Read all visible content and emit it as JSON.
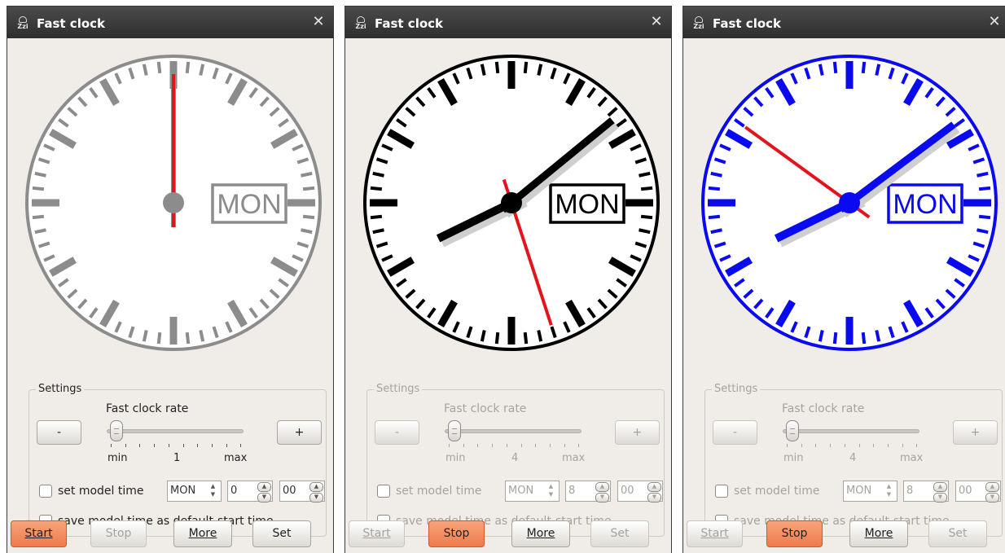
{
  "windows": [
    {
      "title": "Fast clock",
      "close_glyph": "✕",
      "clock": {
        "time": {
          "hour": 12,
          "minute": 0,
          "second": 0
        },
        "day_label": "MON",
        "face_color": "#8c8c8c",
        "second_hand_color": "#e3141c",
        "hands_visible": false
      },
      "settings": {
        "legend": "Settings",
        "rate_label": "Fast clock rate",
        "minus_label": "-",
        "plus_label": "+",
        "rate_min_label": "min",
        "rate_value": "1",
        "rate_max_label": "max",
        "rate_slider_fraction": 0.05,
        "set_model_time_label": "set model time",
        "set_model_time_checked": false,
        "day_value": "MON",
        "hour_value": "0",
        "minute_value": "00",
        "save_default_label": "save model time as default-start time",
        "save_default_checked": false,
        "controls_enabled": true
      },
      "buttons": {
        "start_label": "Start",
        "stop_label": "Stop",
        "more_label": "More",
        "set_label": "Set",
        "active": "start"
      }
    },
    {
      "title": "Fast clock",
      "close_glyph": "✕",
      "clock": {
        "time": {
          "hour": 8,
          "minute": 8,
          "second": 27
        },
        "day_label": "MON",
        "face_color": "#000000",
        "second_hand_color": "#e3141c",
        "hands_visible": true
      },
      "settings": {
        "legend": "Settings",
        "rate_label": "Fast clock rate",
        "minus_label": "-",
        "plus_label": "+",
        "rate_min_label": "min",
        "rate_value": "4",
        "rate_max_label": "max",
        "rate_slider_fraction": 0.05,
        "set_model_time_label": "set model time",
        "set_model_time_checked": false,
        "day_value": "MON",
        "hour_value": "8",
        "minute_value": "00",
        "save_default_label": "save model time as default-start time",
        "save_default_checked": false,
        "controls_enabled": false
      },
      "buttons": {
        "start_label": "Start",
        "stop_label": "Stop",
        "more_label": "More",
        "set_label": "Set",
        "active": "stop"
      }
    },
    {
      "title": "Fast clock",
      "close_glyph": "✕",
      "clock": {
        "time": {
          "hour": 8,
          "minute": 8,
          "second": 51
        },
        "day_label": "MON",
        "face_color": "#0a0af0",
        "second_hand_color": "#e3141c",
        "hands_visible": true
      },
      "settings": {
        "legend": "Settings",
        "rate_label": "Fast clock rate",
        "minus_label": "-",
        "plus_label": "+",
        "rate_min_label": "min",
        "rate_value": "4",
        "rate_max_label": "max",
        "rate_slider_fraction": 0.05,
        "set_model_time_label": "set model time",
        "set_model_time_checked": false,
        "day_value": "MON",
        "hour_value": "8",
        "minute_value": "00",
        "save_default_label": "save model time as default-start time",
        "save_default_checked": false,
        "controls_enabled": false
      },
      "buttons": {
        "start_label": "Start",
        "stop_label": "Stop",
        "more_label": "More",
        "set_label": "Set",
        "active": "stop"
      }
    }
  ]
}
